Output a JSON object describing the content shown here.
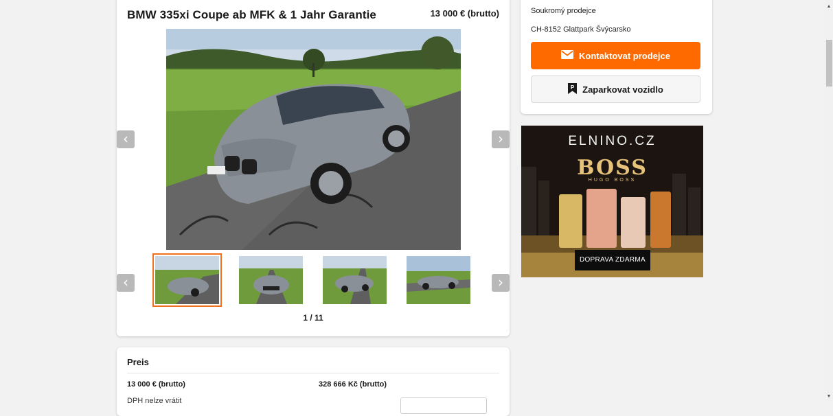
{
  "listing": {
    "title": "BMW 335xi Coupe ab MFK & 1 Jahr Garantie",
    "price": "13 000 € (brutto)",
    "photo_counter": "1 / 11",
    "thumbnail_count": 4
  },
  "seller": {
    "type": "Soukromý prodejce",
    "location": "CH-8152 Glattpark Švýcarsko",
    "contact_label": "Kontaktovat prodejce",
    "park_label": "Zaparkovat vozidlo"
  },
  "ad": {
    "brand": "ELNINO.CZ",
    "product": "BOSS",
    "subline": "HUGO BOSS",
    "cta": "DOPRAVA ZDARMA"
  },
  "price_section": {
    "title": "Preis",
    "price_eur": "13 000 € (brutto)",
    "price_czk": "328 666 Kč (brutto)",
    "vat_label": "DPH nelze vrátit"
  },
  "colors": {
    "accent": "#ff6a00",
    "active_thumb_border": "#f07020",
    "page_bg": "#f2f2f2"
  },
  "icons": {
    "prev": "chevron-left-icon",
    "next": "chevron-right-icon",
    "contact": "envelope-icon",
    "park": "bookmark-icon"
  }
}
